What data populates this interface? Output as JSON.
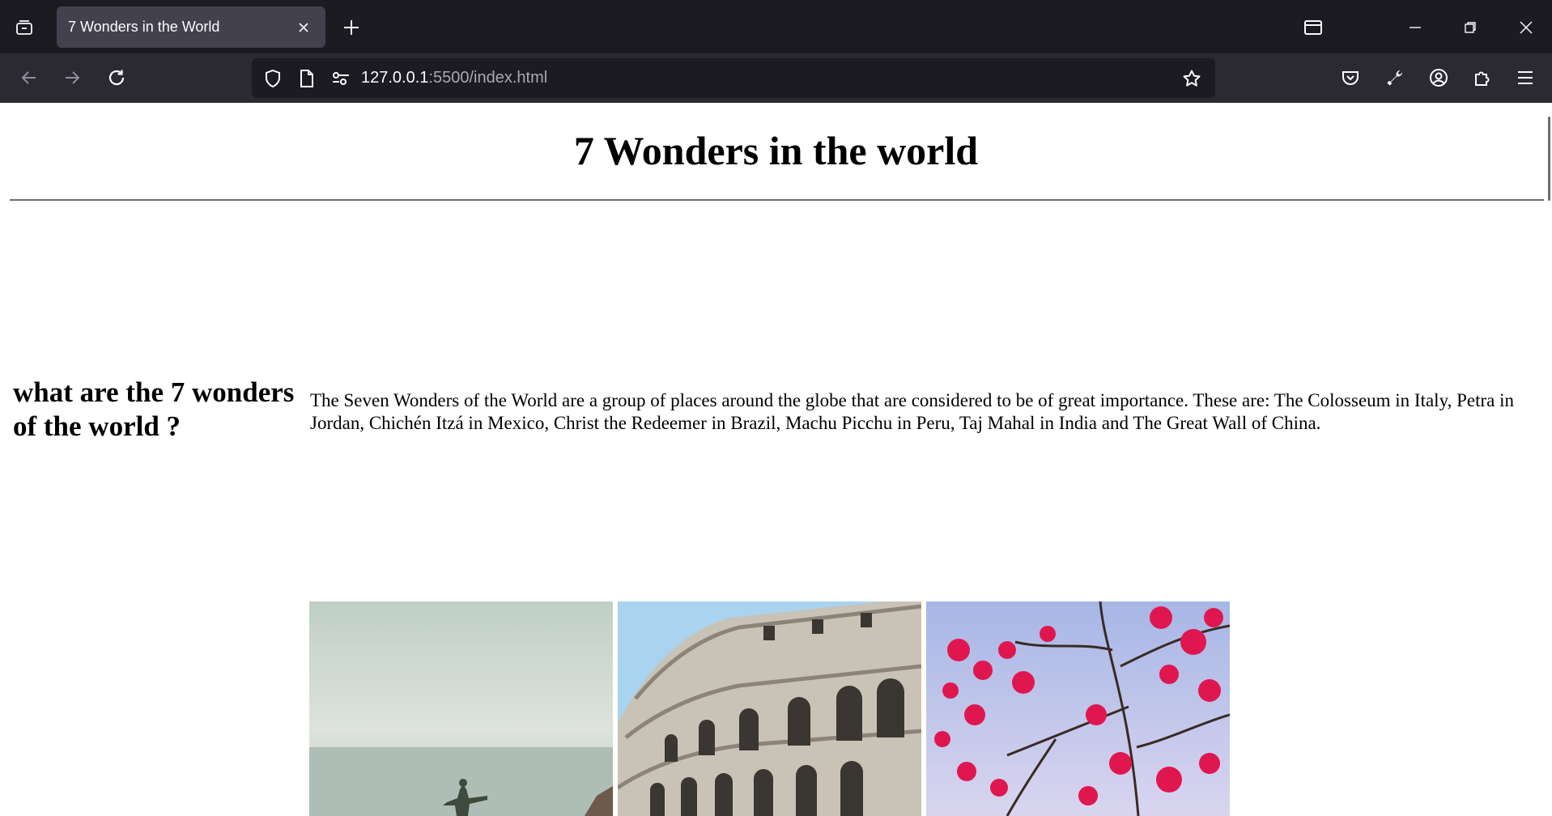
{
  "browser": {
    "tab": {
      "title": "7 Wonders in the World"
    },
    "url": {
      "host": "127.0.0.1",
      "path": ":5500/index.html"
    },
    "icons": {
      "tab_list": "tab-list-icon",
      "close_tab": "close-icon",
      "new_tab": "plus-icon",
      "tab_overview": "tab-overview-icon",
      "minimize": "minimize-icon",
      "restore": "restore-icon",
      "close_window": "close-icon",
      "back": "arrow-left-icon",
      "forward": "arrow-right-icon",
      "reload": "reload-icon",
      "tracking_protection": "shield-icon",
      "page_info": "page-icon",
      "site_permissions": "permissions-icon",
      "bookmark": "star-icon",
      "pocket": "pocket-icon",
      "dev_tools": "wrench-icon",
      "account": "account-icon",
      "extensions": "puzzle-icon",
      "menu": "hamburger-menu-icon"
    }
  },
  "page": {
    "title": "7 Wonders in the world",
    "side_heading": "what are the 7 wonders of the world ?",
    "intro": "The Seven Wonders of the World are a group of places around the globe that are considered to be of great importance. These are: The Colosseum in Italy, Petra in Jordan, Chichén Itzá in Mexico, Christ the Redeemer in Brazil, Machu Picchu in Peru, Taj Mahal in India and The Great Wall of China.",
    "photos": [
      {
        "subject": "christ-the-redeemer"
      },
      {
        "subject": "colosseum"
      },
      {
        "subject": "flowering-tree"
      }
    ]
  },
  "colors": {
    "tab_strip": "#1c1b22",
    "toolbar": "#2b2a33",
    "active_tab": "#42414d",
    "url_field": "#1c1b22",
    "chrome_text": "#fbfbfe",
    "url_path": "#a9a8b3",
    "page_background": "#ffffff",
    "rule": "#6e6e6e"
  }
}
